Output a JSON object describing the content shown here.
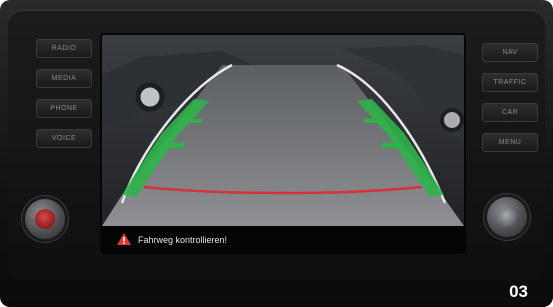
{
  "left_buttons": [
    "RADIO",
    "MEDIA",
    "PHONE",
    "VOICE"
  ],
  "right_buttons": [
    "NAV",
    "TRAFFIC",
    "CAR",
    "MENU"
  ],
  "status": {
    "warning_text": "Fahrweg kontrollieren!"
  },
  "figure_number": "03",
  "colors": {
    "guide_green": "#2fb24a",
    "stop_line_red": "#d8313a",
    "warning_red": "#e23a30"
  }
}
